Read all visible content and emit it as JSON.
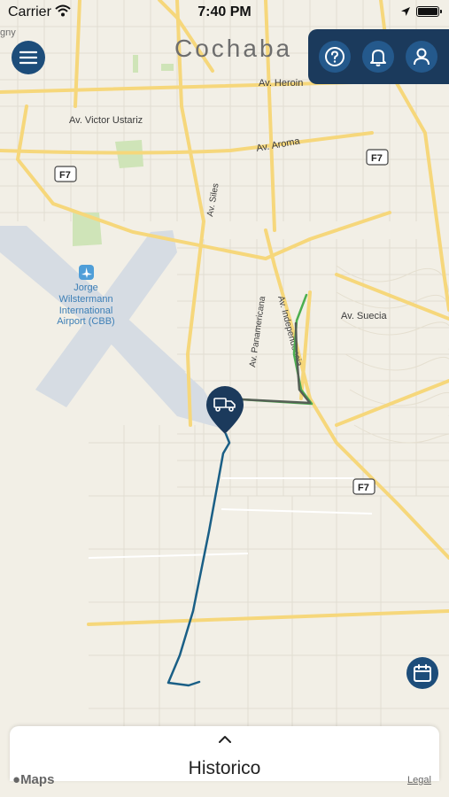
{
  "status_bar": {
    "carrier": "Carrier",
    "time": "7:40 PM"
  },
  "map": {
    "city_label": "Cochaba",
    "corner_label": "gny",
    "streets": [
      "Av. Heroin",
      "Av. Victor Ustariz",
      "Av. Aroma",
      "Av. Siles",
      "Av. Suecia",
      "Av. Panamericana",
      "Av. Independencia"
    ],
    "highway_shield": "F7",
    "airport_label": [
      "Jorge",
      "Wilstermann",
      "International",
      "Airport (CBB)"
    ],
    "vehicle_marker_icon": "truck-icon",
    "route_colors": {
      "primary": "#1a5f86",
      "secondary": "#4caf50",
      "dark": "#555f55"
    }
  },
  "buttons": {
    "menu_icon": "menu-icon",
    "help_icon": "help-icon",
    "notifications_icon": "bell-icon",
    "profile_icon": "user-icon",
    "calendar_icon": "calendar-icon"
  },
  "bottom_sheet": {
    "label": "Historico"
  },
  "attribution": {
    "maps": "Maps",
    "legal": "Legal"
  },
  "colors": {
    "accent": "#1d4d7a",
    "panel": "#1b3a5c"
  }
}
